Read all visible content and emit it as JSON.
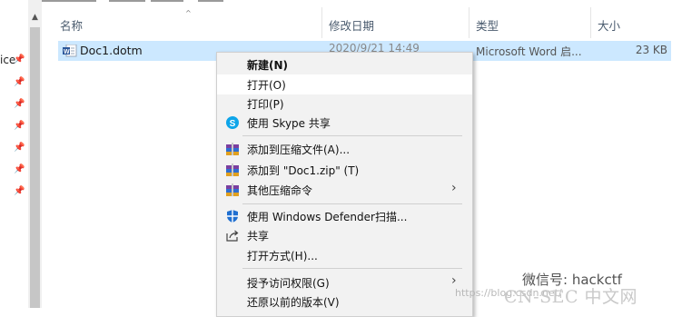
{
  "nav": {
    "fragment_label": "ice",
    "pins": [
      "📌",
      "📌",
      "📌",
      "📌",
      "📌",
      "📌",
      "📌"
    ]
  },
  "columns": {
    "name": "名称",
    "date": "修改日期",
    "type": "类型",
    "size": "大小"
  },
  "file": {
    "name": "Doc1.dotm",
    "date": "2020/9/21 14:49",
    "type": "Microsoft Word 启...",
    "size": "23 KB"
  },
  "context_menu": {
    "items": [
      {
        "label": "新建(N)",
        "bold": true
      },
      {
        "label": "打开(O)"
      },
      {
        "label": "打印(P)"
      },
      {
        "label": "使用 Skype 共享",
        "icon": "skype-icon"
      },
      {
        "label": "添加到压缩文件(A)...",
        "icon": "archive-icon"
      },
      {
        "label": "添加到 \"Doc1.zip\" (T)",
        "icon": "archive-icon"
      },
      {
        "label": "其他压缩命令",
        "icon": "archive-icon",
        "submenu": true
      },
      {
        "label": "使用 Windows Defender扫描...",
        "icon": "defender-icon"
      },
      {
        "label": "共享",
        "icon": "share-icon"
      },
      {
        "label": "打开方式(H)..."
      },
      {
        "label": "授予访问权限(G)",
        "submenu": true
      },
      {
        "label": "还原以前的版本(V)"
      }
    ],
    "submenu_arrow": "›"
  },
  "watermark": {
    "wechat": "微信号: hackctf",
    "url": "https://blog.csdn.net/",
    "cnsec": "CN-SEC 中文网"
  },
  "colors": {
    "selection": "#cce8ff",
    "menu_bg": "#f2f2f2",
    "header_text": "#4a5b6e"
  }
}
